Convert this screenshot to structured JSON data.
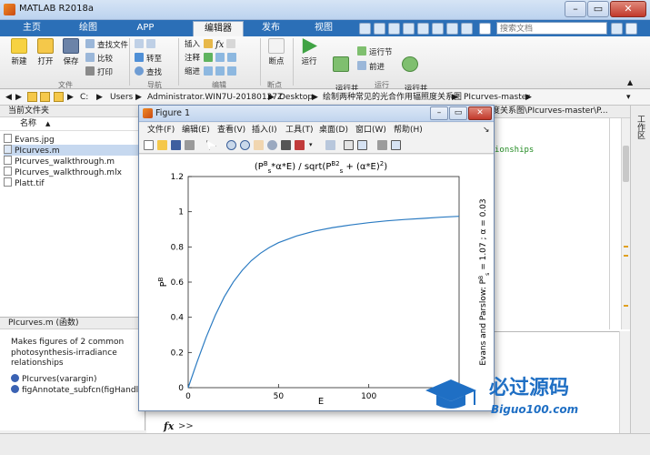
{
  "window": {
    "title": "MATLAB R2018a"
  },
  "tabs": [
    {
      "label": "主页"
    },
    {
      "label": "绘图"
    },
    {
      "label": "APP"
    },
    {
      "label": "编辑器",
      "active": true
    },
    {
      "label": "发布"
    },
    {
      "label": "视图"
    }
  ],
  "search": {
    "placeholder": "搜索文档"
  },
  "ribbon": {
    "new": "新建",
    "open": "打开",
    "save": "保存",
    "find_files": "查找文件",
    "compare": "比较",
    "print": "打印",
    "file_group": "文件",
    "goto": "转至",
    "find": "查找",
    "nav_group": "导航",
    "insert": "插入",
    "comment": "注释",
    "indent": "缩进",
    "fx": "fx",
    "edit_group": "编辑",
    "breakpoints": "断点",
    "bp_group": "断点",
    "run": "运行",
    "run_advance": "运行并\n前进",
    "run_section": "运行节",
    "advance": "前进",
    "run_time": "运行并\n计时",
    "run_group": "运行"
  },
  "address": {
    "drive": "C:",
    "crumbs": [
      "Users",
      "Administrator.WIN7U-20180127Z",
      "Desktop",
      "绘制两种常见的光合作用辐照度关系图",
      "PIcurves-master"
    ]
  },
  "current_folder": {
    "header": "当前文件夹",
    "col_name": "名称",
    "files": [
      {
        "name": "Evans.jpg",
        "selected": false
      },
      {
        "name": "PIcurves.m",
        "selected": true
      },
      {
        "name": "PIcurves_walkthrough.m",
        "selected": false
      },
      {
        "name": "PIcurves_walkthrough.mlx",
        "selected": false
      },
      {
        "name": "Platt.tif",
        "selected": false
      }
    ]
  },
  "details": {
    "header": "PIcurves.m (函数)",
    "description": "Makes figures of 2 common photosynthesis-irradiance relationships",
    "functions": [
      "PIcurves(varargin)",
      "figAnnotate_subfcn(figHandle, ..."
    ]
  },
  "editor": {
    "path_tab": "度关系图\\PIcurves-master\\P...",
    "code_fragment": "ionships"
  },
  "workspace_tab": "工作区",
  "command": {
    "prompt": "fx",
    "chevrons": ">>"
  },
  "figure": {
    "title": "Figure 1",
    "menu": [
      "文件(F)",
      "编辑(E)",
      "查看(V)",
      "插入(I)",
      "工具(T)",
      "桌面(D)",
      "窗口(W)",
      "帮助(H)"
    ]
  },
  "chart_data": {
    "type": "line",
    "title": "(P_s^B*α*E) / sqrt(P_s^B2 + (α*E)^2)",
    "xlabel": "E",
    "ylabel": "P^B",
    "right_label": "Evans and Parslow: P_s^B = 1.07 ; α = 0.03",
    "xlim": [
      0,
      150
    ],
    "ylim": [
      0,
      1.2
    ],
    "xticks": [
      0,
      50,
      100
    ],
    "yticks": [
      0,
      0.2,
      0.4,
      0.6,
      0.8,
      1,
      1.2
    ],
    "series": [
      {
        "color": "#2b7bc2",
        "params": {
          "PsB": 1.07,
          "alpha": 0.03
        },
        "x": [
          0,
          5,
          10,
          15,
          20,
          25,
          30,
          35,
          40,
          45,
          50,
          60,
          70,
          80,
          90,
          100,
          110,
          120,
          130,
          140,
          150
        ],
        "y": [
          0,
          0.148,
          0.288,
          0.411,
          0.516,
          0.601,
          0.668,
          0.722,
          0.764,
          0.797,
          0.824,
          0.862,
          0.89,
          0.91,
          0.925,
          0.938,
          0.948,
          0.956,
          0.962,
          0.969,
          0.974
        ]
      }
    ]
  },
  "watermark": {
    "text": "必过源码",
    "url": "Biguo100.com"
  },
  "colors": {
    "ribbon_tab_bar": "#2b6fb7",
    "plot_line": "#2b7bc2"
  }
}
